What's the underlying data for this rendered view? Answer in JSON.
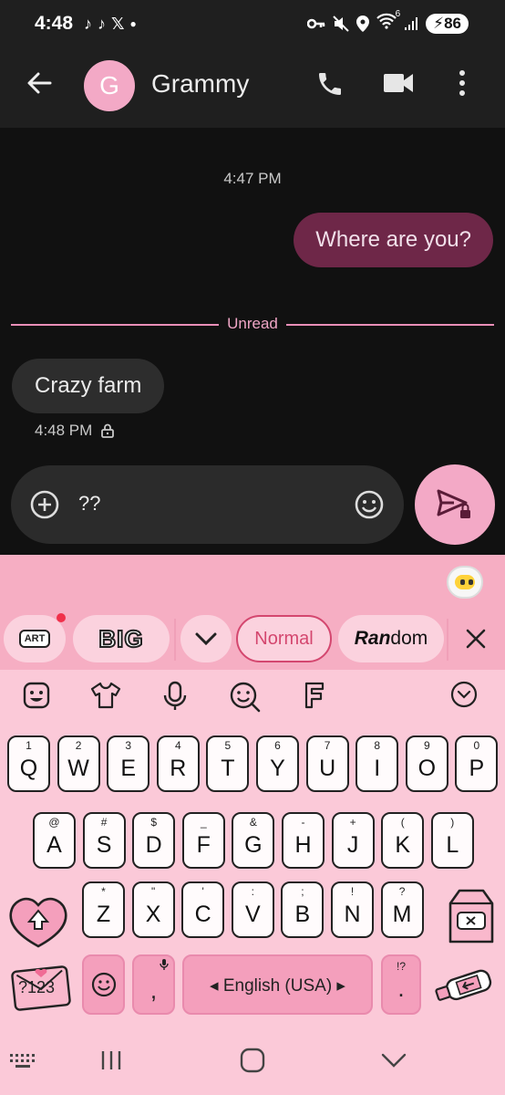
{
  "status": {
    "time": "4:48",
    "notification_icons": [
      "tiktok-icon",
      "tiktok-icon",
      "x-icon",
      "dot-icon"
    ],
    "system_icons": [
      "vpn-key-icon",
      "mute-icon",
      "location-icon",
      "wifi-icon",
      "signal-icon"
    ],
    "wifi_badge": "6",
    "battery": "86"
  },
  "header": {
    "avatar_letter": "G",
    "contact_name": "Grammy"
  },
  "conversation": {
    "timestamp": "4:47 PM",
    "outgoing": "Where are you?",
    "divider_label": "Unread",
    "incoming": "Crazy farm",
    "incoming_time": "4:48 PM"
  },
  "compose": {
    "text": "??"
  },
  "keyboard": {
    "chips": {
      "art": "ART",
      "big": "BIG",
      "normal": "Normal",
      "random_bold": "Ran",
      "random_rest": "dom"
    },
    "rows": [
      [
        {
          "k": "Q",
          "a": "1"
        },
        {
          "k": "W",
          "a": "2"
        },
        {
          "k": "E",
          "a": "3"
        },
        {
          "k": "R",
          "a": "4"
        },
        {
          "k": "T",
          "a": "5"
        },
        {
          "k": "Y",
          "a": "6"
        },
        {
          "k": "U",
          "a": "7"
        },
        {
          "k": "I",
          "a": "8"
        },
        {
          "k": "O",
          "a": "9"
        },
        {
          "k": "P",
          "a": "0"
        }
      ],
      [
        {
          "k": "A",
          "a": "@"
        },
        {
          "k": "S",
          "a": "#"
        },
        {
          "k": "D",
          "a": "$"
        },
        {
          "k": "F",
          "a": "_"
        },
        {
          "k": "G",
          "a": "&"
        },
        {
          "k": "H",
          "a": "-"
        },
        {
          "k": "J",
          "a": "+"
        },
        {
          "k": "K",
          "a": "("
        },
        {
          "k": "L",
          "a": ")"
        }
      ],
      [
        {
          "k": "Z",
          "a": "*"
        },
        {
          "k": "X",
          "a": "\""
        },
        {
          "k": "C",
          "a": "'"
        },
        {
          "k": "V",
          "a": ":"
        },
        {
          "k": "B",
          "a": ";"
        },
        {
          "k": "N",
          "a": "!"
        },
        {
          "k": "M",
          "a": "?"
        }
      ]
    ],
    "symbols_label": "?123",
    "comma": ",",
    "space_label": "English (USA)",
    "period": ".",
    "period_alt": "!?"
  },
  "colors": {
    "accent_pink": "#f3a9c6",
    "outgoing_bubble": "#6e2748",
    "keyboard_bg": "#fbc9d8"
  }
}
